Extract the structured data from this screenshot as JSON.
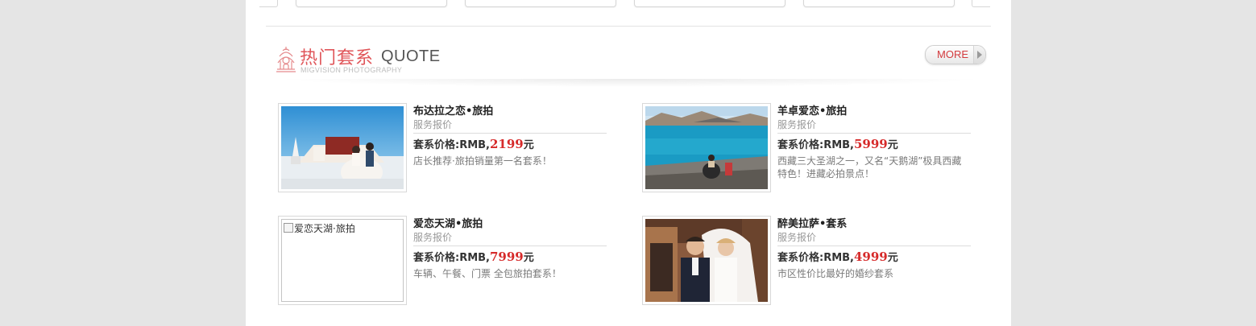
{
  "section": {
    "title_cn": "热门套系",
    "title_en": "QUOTE",
    "subtitle": "MIGVISION PHOTOGRAPHY",
    "more_label": "MORE"
  },
  "packages": [
    {
      "name": "布达拉之恋•旅拍",
      "sub": "服务报价",
      "price_prefix": "套系价格:RMB,",
      "price": "2199",
      "price_suffix": "元",
      "desc": "店长推荐·旅拍销量第一名套系！",
      "image_alt": "布达拉之恋·旅拍",
      "image_loaded": true
    },
    {
      "name": "羊卓爱恋•旅拍",
      "sub": "服务报价",
      "price_prefix": "套系价格:RMB,",
      "price": "5999",
      "price_suffix": "元",
      "desc": "西藏三大圣湖之一，又名“天鹅湖”极具西藏特色！进藏必拍景点！",
      "image_alt": "羊卓爱恋·旅拍",
      "image_loaded": true
    },
    {
      "name": "爱恋天湖•旅拍",
      "sub": "服务报价",
      "price_prefix": "套系价格:RMB,",
      "price": "7999",
      "price_suffix": "元",
      "desc": "车辆、午餐、门票 全包旅拍套系！",
      "image_alt": "爱恋天湖·旅拍",
      "image_loaded": false
    },
    {
      "name": "醉美拉萨•套系",
      "sub": "服务报价",
      "price_prefix": "套系价格:RMB,",
      "price": "4999",
      "price_suffix": "元",
      "desc": "市区性价比最好的婚纱套系",
      "image_alt": "醉美拉萨·套系",
      "image_loaded": true
    }
  ],
  "colors": {
    "accent_red": "#e0565a",
    "price_red": "#d62a2a",
    "page_bg": "#e5e5e5"
  }
}
